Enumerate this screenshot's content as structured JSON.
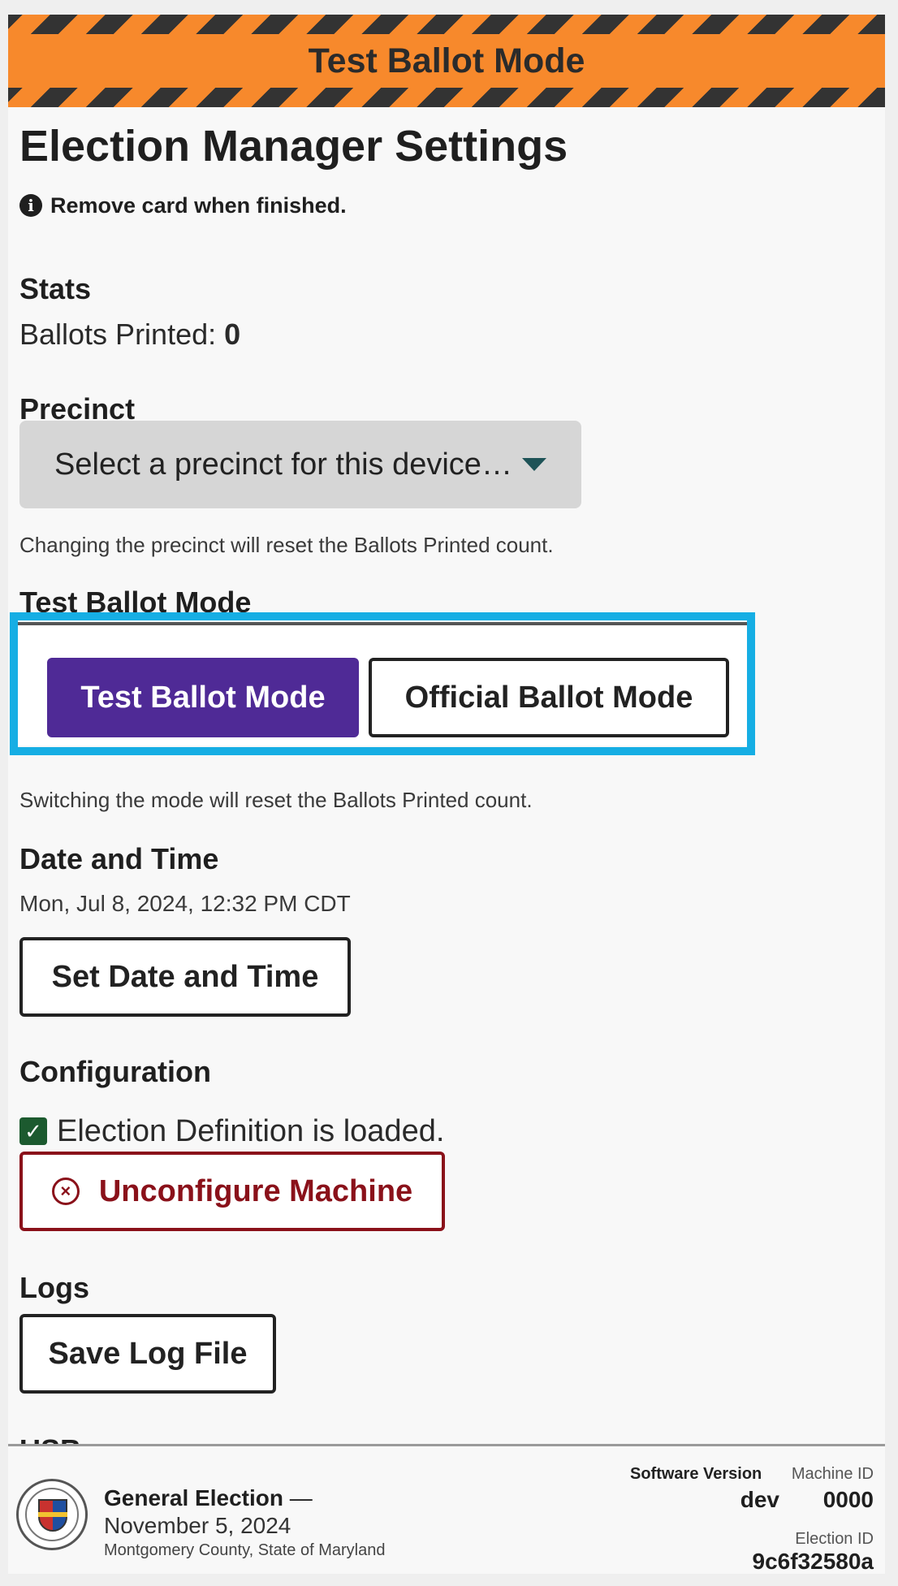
{
  "banner": {
    "title": "Test Ballot Mode"
  },
  "page": {
    "title": "Election Manager Settings",
    "card_note": "Remove card when finished."
  },
  "stats": {
    "heading": "Stats",
    "ballots_printed_label": "Ballots Printed:",
    "ballots_printed_value": "0"
  },
  "precinct": {
    "heading": "Precinct",
    "select_value": "Select a precinct for this device…",
    "hint": "Changing the precinct will reset the Ballots Printed count."
  },
  "ballot_mode": {
    "heading": "Test Ballot Mode",
    "test_label": "Test Ballot Mode",
    "official_label": "Official Ballot Mode",
    "selected": "Test Ballot Mode",
    "hint": "Switching the mode will reset the Ballots Printed count."
  },
  "datetime": {
    "heading": "Date and Time",
    "current": "Mon, Jul 8, 2024, 12:32 PM CDT",
    "button_label": "Set Date and Time"
  },
  "configuration": {
    "heading": "Configuration",
    "status": "Election Definition is loaded.",
    "unconfigure_label": "Unconfigure Machine"
  },
  "logs": {
    "heading": "Logs",
    "save_label": "Save Log File"
  },
  "usb": {
    "heading": "USB"
  },
  "footer": {
    "election_title": "General Election",
    "election_separator": "—",
    "election_date": "November 5, 2024",
    "county": "Montgomery County, State of Maryland",
    "software_version_label": "Software Version",
    "software_version": "dev",
    "machine_id_label": "Machine ID",
    "machine_id": "0000",
    "election_id_label": "Election ID",
    "election_id": "9c6f32580a"
  },
  "colors": {
    "banner_orange": "#f7892c",
    "test_mode_purple": "#4f2a96",
    "highlight_blue": "#16aee4",
    "danger_red": "#8a111a",
    "check_green": "#1c5a2f"
  },
  "icons": [
    "info-icon",
    "dropdown-caret-icon",
    "checkbox-checked-icon",
    "circle-x-icon",
    "county-seal-icon"
  ]
}
